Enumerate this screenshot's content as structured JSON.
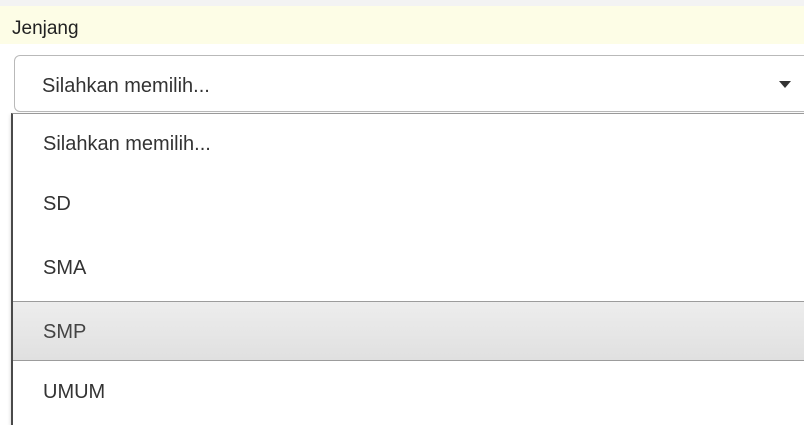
{
  "field": {
    "label": "Jenjang",
    "selected_value": "Silahkan memilih..."
  },
  "icons": {
    "caret": "caret-down-icon"
  },
  "dropdown": {
    "options": [
      {
        "label": "Silahkan memilih...",
        "highlighted": false
      },
      {
        "label": "SD",
        "highlighted": false
      },
      {
        "label": "SMA",
        "highlighted": false
      },
      {
        "label": "SMP",
        "highlighted": true
      },
      {
        "label": "UMUM",
        "highlighted": false
      }
    ]
  },
  "colors": {
    "label_row_background": "#fdfde6",
    "highlight_background": "#e6e6e6"
  }
}
